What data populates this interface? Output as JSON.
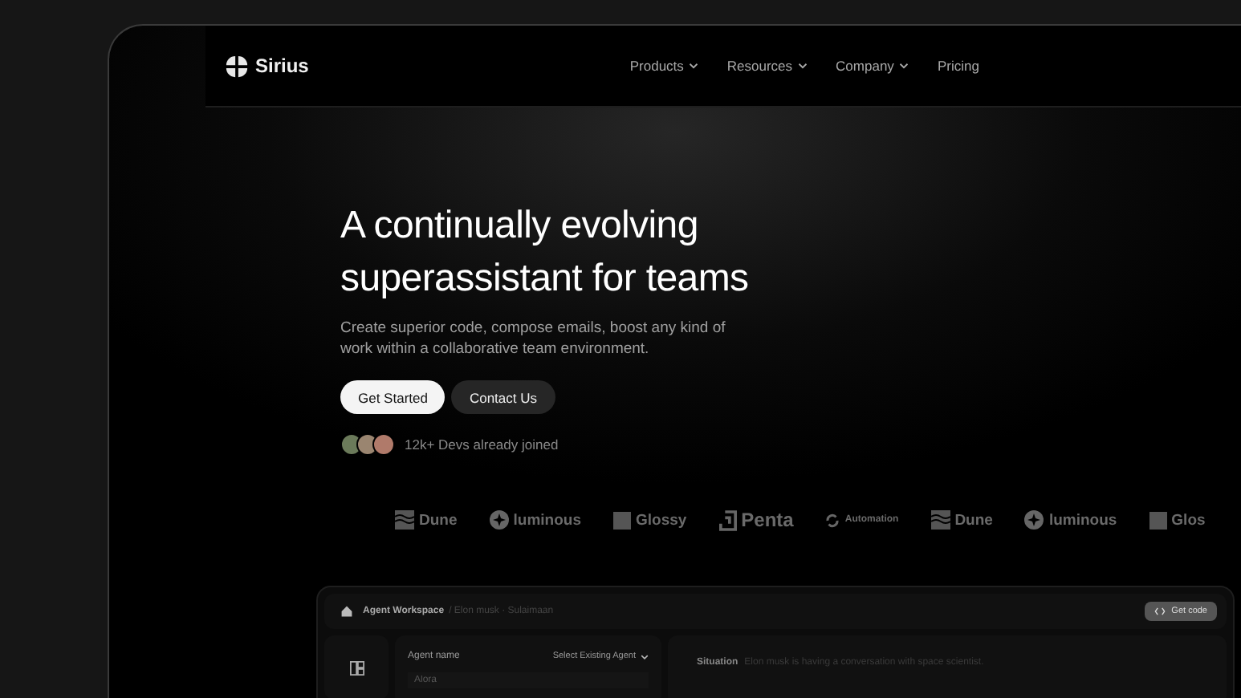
{
  "brand": "Sirius",
  "nav": [
    {
      "label": "Products",
      "dropdown": true
    },
    {
      "label": "Resources",
      "dropdown": true
    },
    {
      "label": "Company",
      "dropdown": true
    },
    {
      "label": "Pricing",
      "dropdown": false
    }
  ],
  "hero": {
    "title_lines": [
      "A continually evolving",
      "superassistant for teams"
    ],
    "subtitle": "Create superior code, compose emails, boost any kind of work within a collaborative team environment.",
    "primary_button": "Get Started",
    "secondary_button": "Contact Us",
    "social_proof": "12k+ Devs already joined"
  },
  "logos": [
    {
      "kind": "dune",
      "name": "Dune"
    },
    {
      "kind": "luminous",
      "name": "luminous"
    },
    {
      "kind": "glossy",
      "name": "Glossy"
    },
    {
      "kind": "penta",
      "name": "Penta"
    },
    {
      "kind": "automation",
      "name": "Automation"
    },
    {
      "kind": "dune",
      "name": "Dune"
    },
    {
      "kind": "luminous",
      "name": "luminous"
    },
    {
      "kind": "glossy",
      "name": "Glos"
    }
  ],
  "preview": {
    "breadcrumb_root": "Agent Workspace",
    "breadcrumb_path": "/ Elon musk · Sulaimaan",
    "get_code_button": "Get code",
    "agent_label": "Agent name",
    "select_agent": "Select Existing Agent",
    "agent_placeholder": "Alora",
    "situation_label": "Situation",
    "situation_text": "Elon musk is having a conversation with space scientist."
  }
}
